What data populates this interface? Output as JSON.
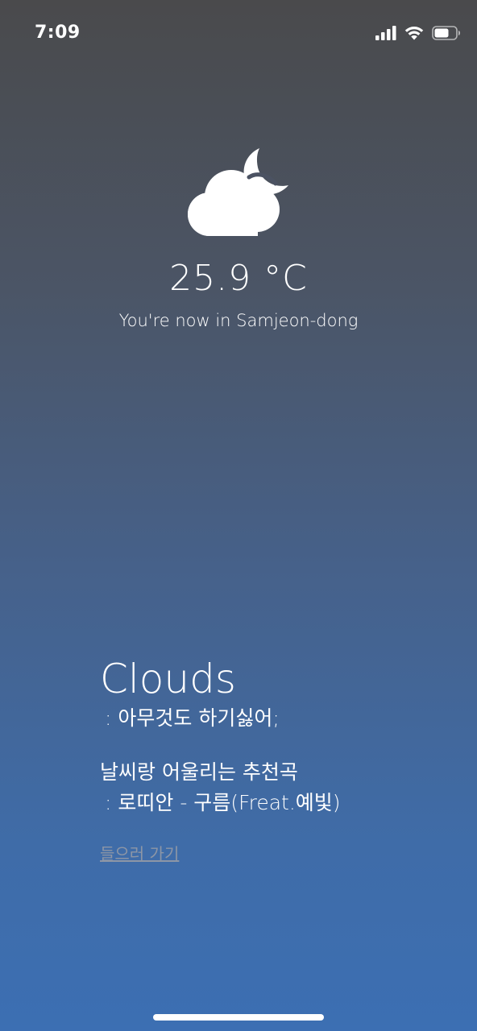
{
  "status_bar": {
    "time": "7:09",
    "icons": [
      "signal-icon",
      "wifi-icon",
      "battery-icon"
    ]
  },
  "weather": {
    "icon": "cloud-moon-icon",
    "temperature": "25.9 °C",
    "location": "You're now in Samjeon-dong",
    "condition": "Clouds",
    "mood": ": 아무것도 하기싫어;"
  },
  "recommendation": {
    "title": "날씨랑 어울리는 추천곡",
    "song": ": 로띠안 - 구름(Freat.예빛)",
    "link_label": "들으러 가기"
  },
  "colors": {
    "background_top": "#4a4a4c",
    "background_bottom": "#3c6fb3",
    "text": "#ffffff",
    "link": "#8d96a6"
  }
}
